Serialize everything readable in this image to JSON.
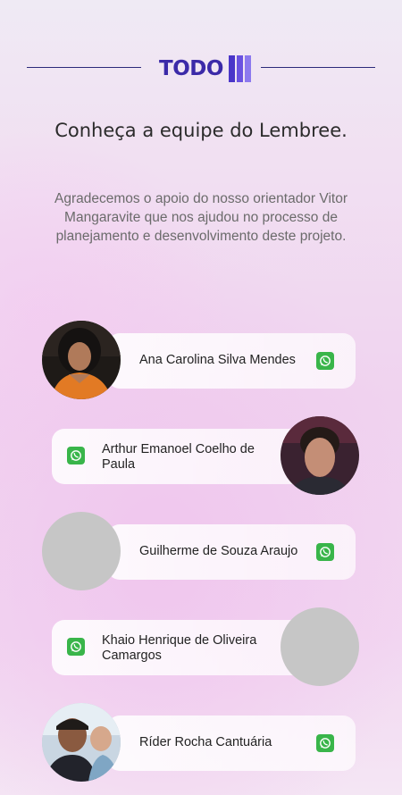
{
  "header": {
    "logo_text": "TODO",
    "brand_colors": {
      "dark": "#3b2aa8",
      "mid": "#6a52e0",
      "light": "#8c79ee"
    }
  },
  "title": "Conheça a equipe do Lembree.",
  "subtitle": "Agradecemos o apoio do nosso orientador Vitor Mangaravite que nos ajudou no processo de planejamento e desenvolvimento deste projeto.",
  "team": [
    {
      "name": "Ana Carolina Silva Mendes",
      "avatar": "photo",
      "contact_icon": "whatsapp-icon"
    },
    {
      "name": "Arthur Emanoel Coelho de Paula",
      "avatar": "photo",
      "contact_icon": "whatsapp-icon"
    },
    {
      "name": "Guilherme de Souza Araujo",
      "avatar": "placeholder",
      "contact_icon": "whatsapp-icon"
    },
    {
      "name": "Khaio Henrique de Oliveira Camargos",
      "avatar": "placeholder",
      "contact_icon": "whatsapp-icon"
    },
    {
      "name": "Ríder Rocha Cantuária",
      "avatar": "photo",
      "contact_icon": "whatsapp-icon"
    }
  ],
  "colors": {
    "whatsapp": "#39b54a",
    "avatar_placeholder": "#c6c6c6"
  }
}
